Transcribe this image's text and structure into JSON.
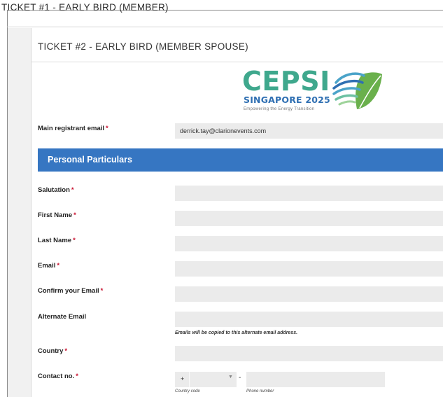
{
  "ticket1": {
    "title": "TICKET #1 - EARLY BIRD (MEMBER)"
  },
  "ticket2": {
    "title": "TICKET #2 - EARLY BIRD (MEMBER SPOUSE)"
  },
  "logo": {
    "name": "CEPSI",
    "subtitle": "SINGAPORE 2025",
    "tagline": "Empowering the Energy Transition",
    "colors": {
      "green": "#3fa88d",
      "blue": "#2f6fb2"
    }
  },
  "form": {
    "main_email": {
      "label": "Main registrant email",
      "value": "derrick.tay@clarionevents.com"
    },
    "section_title": "Personal Particulars",
    "fields": {
      "salutation": "Salutation",
      "first_name": "First Name",
      "last_name": "Last Name",
      "email": "Email",
      "confirm_email": "Confirm your Email",
      "alternate_email": "Alternate Email",
      "alternate_hint": "Emails will be copied to this alternate email address.",
      "country": "Country",
      "contact": "Contact no."
    },
    "contact": {
      "plus": "+",
      "dash": "-",
      "country_code_label": "Country code",
      "phone_label": "Phone number"
    },
    "required_mark": "*"
  },
  "colors": {
    "section_bar": "#3676c2",
    "required": "#c8102e",
    "field_bg": "#ebebeb"
  }
}
